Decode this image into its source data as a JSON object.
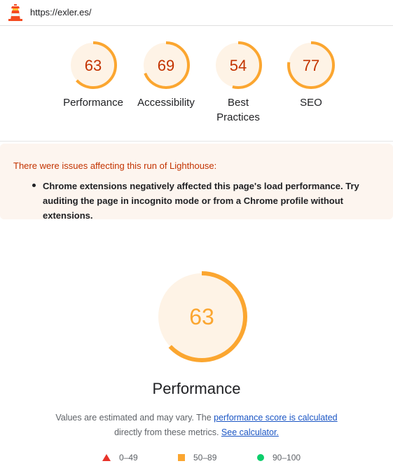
{
  "header": {
    "url": "https://exler.es/"
  },
  "categories": [
    {
      "score": "63",
      "label": "Performance",
      "value": 63
    },
    {
      "score": "69",
      "label": "Accessibility",
      "value": 69
    },
    {
      "score": "54",
      "label": "Best Practices",
      "value": 54
    },
    {
      "score": "77",
      "label": "SEO",
      "value": 77
    }
  ],
  "warning": {
    "title": "There were issues affecting this run of Lighthouse:",
    "items": [
      "Chrome extensions negatively affected this page's load performance. Try auditing the page in incognito mode or from a Chrome profile without extensions."
    ]
  },
  "performance": {
    "score": "63",
    "value": 63,
    "title": "Performance",
    "desc_prefix": "Values are estimated and may vary. The ",
    "link1": "performance score is calculated",
    "desc_middle": "directly from these metrics.",
    "link2": "See calculator."
  },
  "legend": {
    "fail": "0–49",
    "average": "50–89",
    "pass": "90–100"
  },
  "colors": {
    "average": "#fba630",
    "average_text": "#c33300",
    "average_fill": "#fef3e6",
    "fail": "#e8332a",
    "pass": "#0cce6b"
  },
  "icons": {
    "logo": "lighthouse-icon"
  }
}
